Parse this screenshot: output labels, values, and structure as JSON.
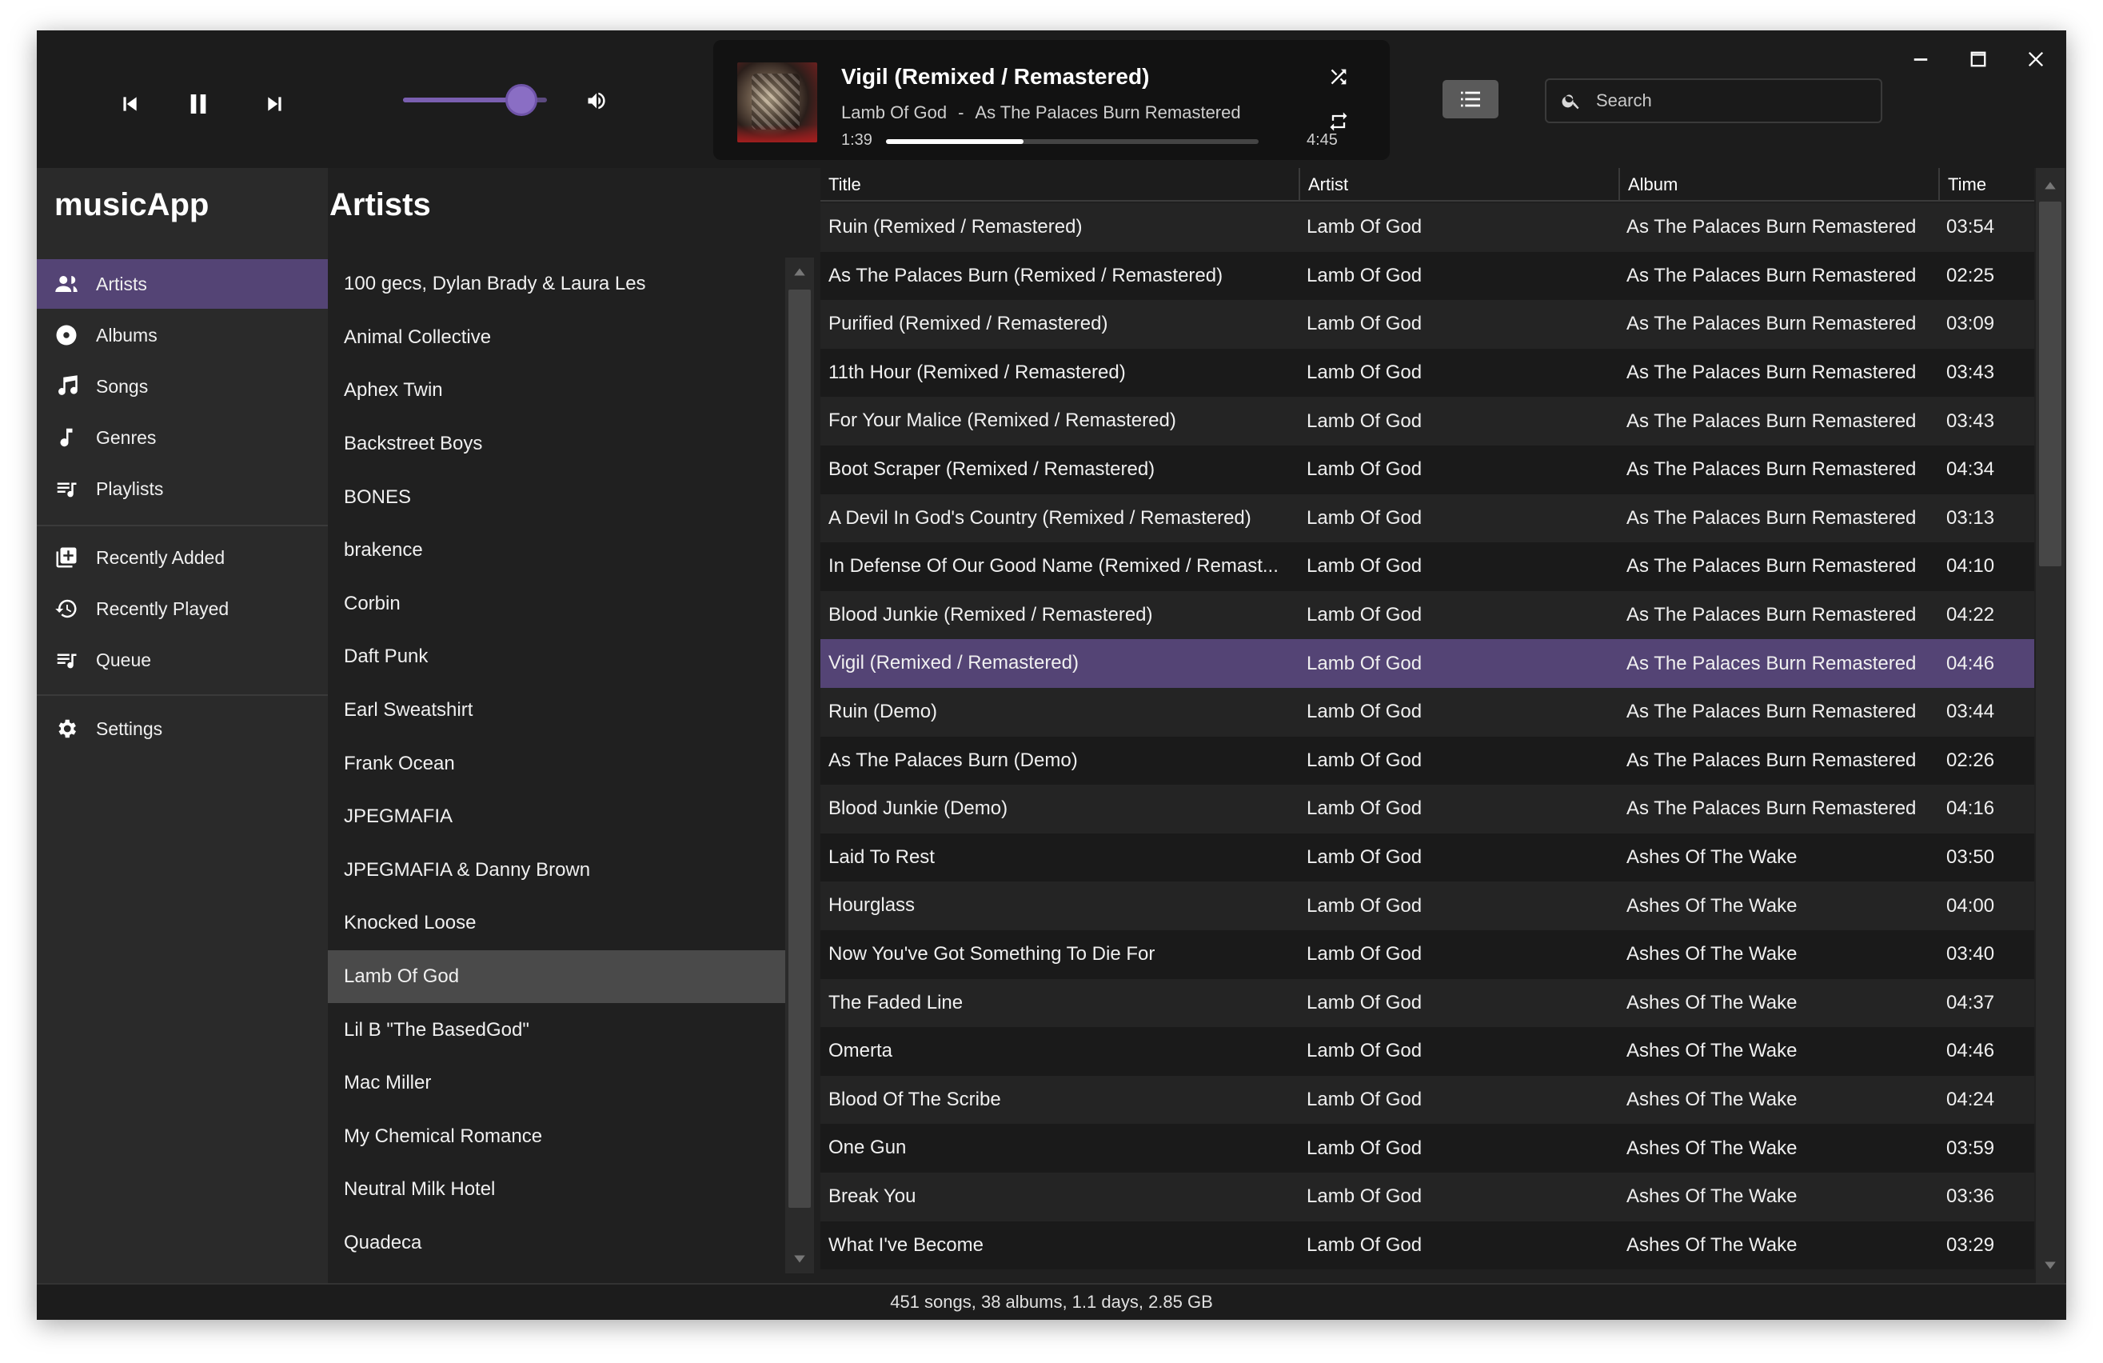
{
  "player": {
    "now_playing": {
      "title": "Vigil (Remixed / Remastered)",
      "artist": "Lamb Of God",
      "separator": "-",
      "album": "As The Palaces Burn Remastered",
      "current_time": "1:39",
      "duration": "4:45",
      "progress_fraction": 0.37
    },
    "volume_fraction": 0.82
  },
  "search": {
    "placeholder": "Search"
  },
  "sidebar": {
    "app_title": "musicApp",
    "items": [
      {
        "label": "Artists",
        "icon": "artists-icon",
        "active": true
      },
      {
        "label": "Albums",
        "icon": "album-icon"
      },
      {
        "label": "Songs",
        "icon": "songs-icon"
      },
      {
        "label": "Genres",
        "icon": "genre-icon"
      },
      {
        "label": "Playlists",
        "icon": "playlist-icon"
      },
      {
        "label": "Recently Added",
        "icon": "recently-added-icon"
      },
      {
        "label": "Recently Played",
        "icon": "history-icon"
      },
      {
        "label": "Queue",
        "icon": "queue-icon"
      },
      {
        "label": "Settings",
        "icon": "gear-icon"
      }
    ]
  },
  "artists": {
    "title": "Artists",
    "selected": "Lamb Of God",
    "items": [
      "100 gecs, Dylan Brady & Laura Les",
      "Animal Collective",
      "Aphex Twin",
      "Backstreet Boys",
      "BONES",
      "brakence",
      "Corbin",
      "Daft Punk",
      "Earl Sweatshirt",
      "Frank Ocean",
      "JPEGMAFIA",
      "JPEGMAFIA & Danny Brown",
      "Knocked Loose",
      "Lamb Of God",
      "Lil B \"The BasedGod\"",
      "Mac Miller",
      "My Chemical Romance",
      "Neutral Milk Hotel",
      "Quadeca"
    ]
  },
  "songs": {
    "columns": [
      "Title",
      "Artist",
      "Album",
      "Time"
    ],
    "selected_index": 9,
    "rows": [
      [
        "Ruin (Remixed / Remastered)",
        "Lamb Of God",
        "As The Palaces Burn Remastered",
        "03:54"
      ],
      [
        "As The Palaces Burn (Remixed / Remastered)",
        "Lamb Of God",
        "As The Palaces Burn Remastered",
        "02:25"
      ],
      [
        "Purified (Remixed / Remastered)",
        "Lamb Of God",
        "As The Palaces Burn Remastered",
        "03:09"
      ],
      [
        "11th Hour (Remixed / Remastered)",
        "Lamb Of God",
        "As The Palaces Burn Remastered",
        "03:43"
      ],
      [
        "For Your Malice (Remixed / Remastered)",
        "Lamb Of God",
        "As The Palaces Burn Remastered",
        "03:43"
      ],
      [
        "Boot Scraper (Remixed / Remastered)",
        "Lamb Of God",
        "As The Palaces Burn Remastered",
        "04:34"
      ],
      [
        "A Devil In God's Country (Remixed / Remastered)",
        "Lamb Of God",
        "As The Palaces Burn Remastered",
        "03:13"
      ],
      [
        "In Defense Of Our Good Name (Remixed / Remast...",
        "Lamb Of God",
        "As The Palaces Burn Remastered",
        "04:10"
      ],
      [
        "Blood Junkie (Remixed / Remastered)",
        "Lamb Of God",
        "As The Palaces Burn Remastered",
        "04:22"
      ],
      [
        "Vigil (Remixed / Remastered)",
        "Lamb Of God",
        "As The Palaces Burn Remastered",
        "04:46"
      ],
      [
        "Ruin (Demo)",
        "Lamb Of God",
        "As The Palaces Burn Remastered",
        "03:44"
      ],
      [
        "As The Palaces Burn (Demo)",
        "Lamb Of God",
        "As The Palaces Burn Remastered",
        "02:26"
      ],
      [
        "Blood Junkie (Demo)",
        "Lamb Of God",
        "As The Palaces Burn Remastered",
        "04:16"
      ],
      [
        "Laid To Rest",
        "Lamb Of God",
        "Ashes Of The Wake",
        "03:50"
      ],
      [
        "Hourglass",
        "Lamb Of God",
        "Ashes Of The Wake",
        "04:00"
      ],
      [
        "Now You've Got Something To Die For",
        "Lamb Of God",
        "Ashes Of The Wake",
        "03:40"
      ],
      [
        "The Faded Line",
        "Lamb Of God",
        "Ashes Of The Wake",
        "04:37"
      ],
      [
        "Omerta",
        "Lamb Of God",
        "Ashes Of The Wake",
        "04:46"
      ],
      [
        "Blood Of The Scribe",
        "Lamb Of God",
        "Ashes Of The Wake",
        "04:24"
      ],
      [
        "One Gun",
        "Lamb Of God",
        "Ashes Of The Wake",
        "03:59"
      ],
      [
        "Break You",
        "Lamb Of God",
        "Ashes Of The Wake",
        "03:36"
      ],
      [
        "What I've Become",
        "Lamb Of God",
        "Ashes Of The Wake",
        "03:29"
      ]
    ]
  },
  "status": {
    "summary": "451 songs, 38 albums, 1.1 days, 2.85 GB"
  },
  "colors": {
    "accent": "#544475",
    "background": "#202020"
  }
}
